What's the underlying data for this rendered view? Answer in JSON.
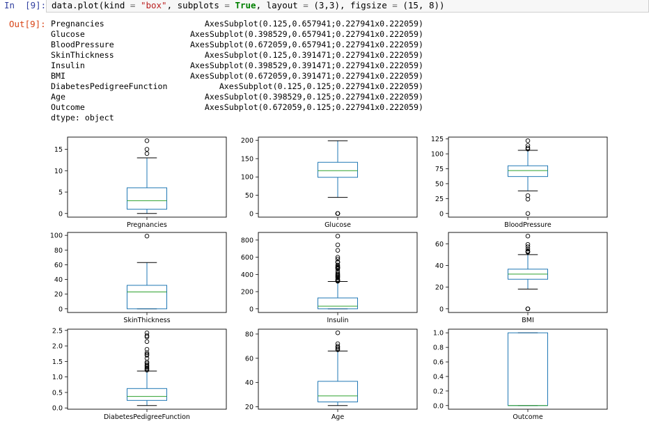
{
  "prompts": {
    "in": "In  [9]:",
    "out": "Out[9]:"
  },
  "code": {
    "prefix": "data.plot(kind ",
    "eq1": "=",
    "kind_value": "\"box\"",
    "mid1": ", subplots ",
    "eq2": "=",
    "subplots_value": "True",
    "mid2": ", layout ",
    "eq3": "=",
    "layout_value": "(3,3)",
    "mid3": ", figsize ",
    "eq4": "=",
    "figsize_value": "(15, 8))"
  },
  "output": {
    "rows": [
      {
        "key": "Pregnancies",
        "value": "AxesSubplot(0.125,0.657941;0.227941x0.222059)"
      },
      {
        "key": "Glucose",
        "value": "AxesSubplot(0.398529,0.657941;0.227941x0.222059)"
      },
      {
        "key": "BloodPressure",
        "value": "AxesSubplot(0.672059,0.657941;0.227941x0.222059)"
      },
      {
        "key": "SkinThickness",
        "value": "AxesSubplot(0.125,0.391471;0.227941x0.222059)"
      },
      {
        "key": "Insulin",
        "value": "AxesSubplot(0.398529,0.391471;0.227941x0.222059)"
      },
      {
        "key": "BMI",
        "value": "AxesSubplot(0.672059,0.391471;0.227941x0.222059)"
      },
      {
        "key": "DiabetesPedigreeFunction",
        "value": "AxesSubplot(0.125,0.125;0.227941x0.222059)"
      },
      {
        "key": "Age",
        "value": "AxesSubplot(0.398529,0.125;0.227941x0.222059)"
      },
      {
        "key": "Outcome",
        "value": "AxesSubplot(0.672059,0.125;0.227941x0.222059)"
      }
    ],
    "dtype": "dtype: object"
  },
  "colors": {
    "box": "#1f77b4",
    "median": "#2ca02c",
    "axis": "#000000",
    "text": "#000000"
  },
  "chart_data": [
    {
      "type": "box",
      "xlabel": "Pregnancies",
      "ylim": [
        -0.85,
        17.85
      ],
      "ticks": [
        0,
        5,
        10,
        15
      ],
      "whisker_low": 0,
      "q1": 1,
      "median": 3,
      "q3": 6,
      "whisker_high": 13,
      "outliers": [
        14,
        15,
        17
      ]
    },
    {
      "type": "box",
      "xlabel": "Glucose",
      "ylim": [
        -9.95,
        208.95
      ],
      "ticks": [
        0,
        50,
        100,
        150,
        200
      ],
      "whisker_low": 44,
      "q1": 99,
      "median": 117,
      "q3": 140,
      "whisker_high": 199,
      "outliers": [
        0,
        0,
        0,
        0,
        0
      ]
    },
    {
      "type": "box",
      "xlabel": "BloodPressure",
      "ylim": [
        -6.1,
        128.1
      ],
      "ticks": [
        0,
        25,
        50,
        75,
        100,
        125
      ],
      "whisker_low": 38,
      "q1": 62,
      "median": 72,
      "q3": 80,
      "whisker_high": 106,
      "outliers": [
        0,
        24,
        30,
        108,
        110,
        114,
        122
      ]
    },
    {
      "type": "box",
      "xlabel": "SkinThickness",
      "ylim": [
        -4.95,
        103.95
      ],
      "ticks": [
        0,
        20,
        40,
        60,
        80,
        100
      ],
      "whisker_low": 0,
      "q1": 0,
      "median": 23,
      "q3": 32,
      "whisker_high": 63,
      "outliers": [
        99
      ]
    },
    {
      "type": "box",
      "xlabel": "Insulin",
      "ylim": [
        -42.3,
        888.3
      ],
      "ticks": [
        0,
        200,
        400,
        600,
        800
      ],
      "whisker_low": 0,
      "q1": 0,
      "median": 30.5,
      "q3": 127,
      "whisker_high": 318,
      "outliers": [
        321,
        325,
        330,
        335,
        342,
        360,
        370,
        375,
        387,
        392,
        400,
        415,
        440,
        465,
        474,
        478,
        480,
        485,
        495,
        510,
        540,
        543,
        545,
        579,
        600,
        680,
        744,
        846
      ]
    },
    {
      "type": "box",
      "xlabel": "BMI",
      "ylim": [
        -3.36,
        70.46
      ],
      "ticks": [
        0,
        20,
        40,
        60
      ],
      "whisker_low": 18.2,
      "q1": 27.3,
      "median": 32,
      "q3": 36.6,
      "whisker_high": 50,
      "outliers": [
        0,
        0,
        0,
        52.3,
        52.9,
        53.2,
        55,
        57.3,
        59.4,
        67.1
      ]
    },
    {
      "type": "box",
      "xlabel": "DiabetesPedigreeFunction",
      "ylim": [
        -0.04,
        2.54
      ],
      "ticks": [
        0.0,
        0.5,
        1.0,
        1.5,
        2.0,
        2.5
      ],
      "whisker_low": 0.078,
      "q1": 0.244,
      "median": 0.373,
      "q3": 0.626,
      "whisker_high": 1.191,
      "outliers": [
        1.22,
        1.25,
        1.28,
        1.32,
        1.35,
        1.39,
        1.44,
        1.48,
        1.6,
        1.7,
        1.73,
        1.78,
        1.89,
        2.14,
        2.29,
        2.33,
        2.42
      ]
    },
    {
      "type": "box",
      "xlabel": "Age",
      "ylim": [
        18,
        84
      ],
      "ticks": [
        20,
        40,
        60,
        80
      ],
      "whisker_low": 21,
      "q1": 24,
      "median": 29,
      "q3": 41,
      "whisker_high": 66,
      "outliers": [
        67,
        68,
        69,
        70,
        72,
        81
      ]
    },
    {
      "type": "box",
      "xlabel": "Outcome",
      "ylim": [
        -0.05,
        1.05
      ],
      "ticks": [
        0.0,
        0.2,
        0.4,
        0.6,
        0.8,
        1.0
      ],
      "whisker_low": 0,
      "q1": 0,
      "median": 0,
      "q3": 1,
      "whisker_high": 1,
      "outliers": []
    }
  ]
}
